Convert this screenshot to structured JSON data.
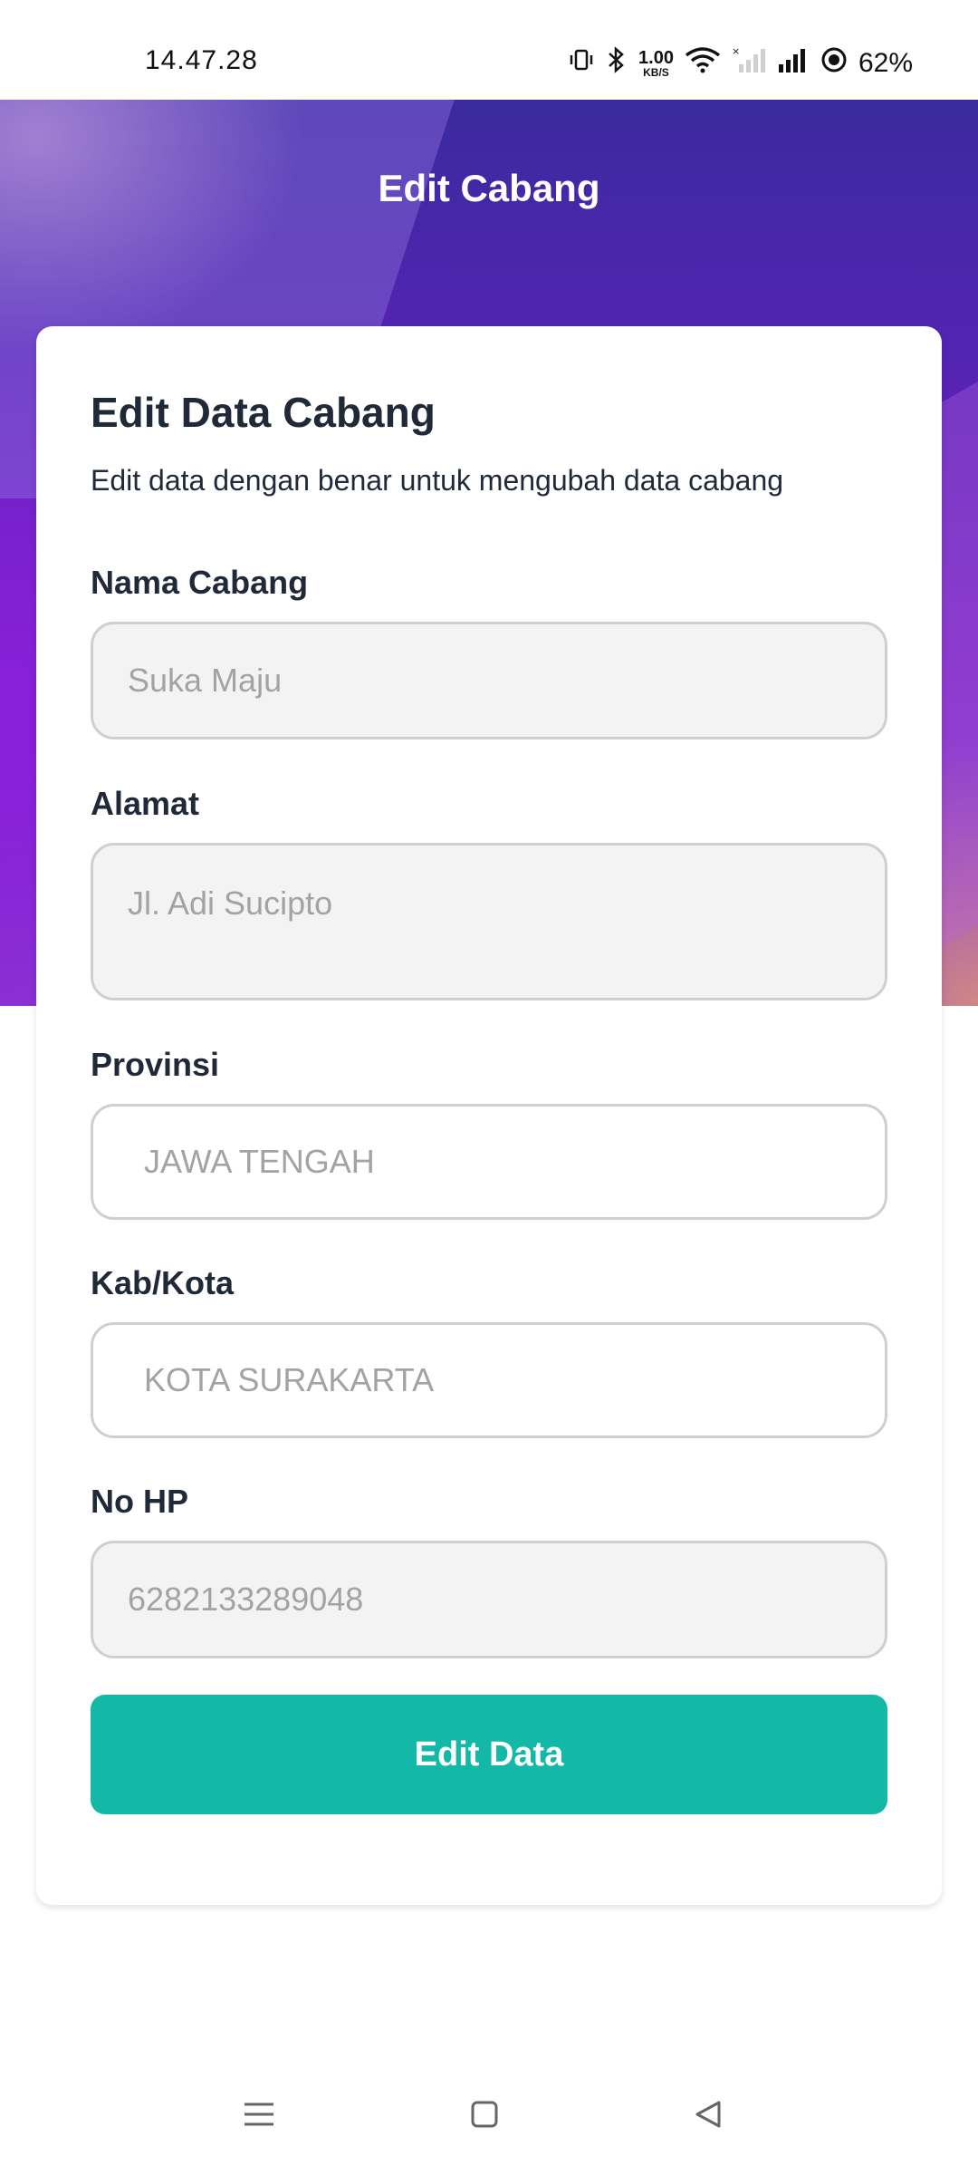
{
  "status_bar": {
    "time": "14.47.28",
    "net_speed_value": "1.00",
    "net_speed_unit": "KB/S",
    "battery": "62%"
  },
  "header": {
    "title": "Edit Cabang"
  },
  "form": {
    "title": "Edit Data Cabang",
    "subtitle": "Edit data dengan benar untuk mengubah data cabang",
    "fields": {
      "nama_cabang": {
        "label": "Nama Cabang",
        "placeholder": "Suka Maju"
      },
      "alamat": {
        "label": "Alamat",
        "placeholder": "Jl. Adi Sucipto"
      },
      "provinsi": {
        "label": "Provinsi",
        "placeholder": "JAWA TENGAH"
      },
      "kab_kota": {
        "label": "Kab/Kota",
        "placeholder": "KOTA SURAKARTA"
      },
      "no_hp": {
        "label": "No HP",
        "placeholder": "6282133289048"
      }
    },
    "submit_label": "Edit Data"
  },
  "colors": {
    "accent": "#14b8a6",
    "header_gradient_start": "#3a2a9e",
    "header_gradient_end": "#8a3ad0",
    "text_primary": "#1f2937",
    "placeholder": "#a3a3a3"
  },
  "icons": {
    "status": [
      "vibrate-icon",
      "bluetooth-icon",
      "wifi-icon",
      "signal-sim2-icon",
      "signal-sim1-icon",
      "battery-icon"
    ],
    "nav": [
      "menu-icon",
      "home-icon",
      "back-icon"
    ]
  }
}
